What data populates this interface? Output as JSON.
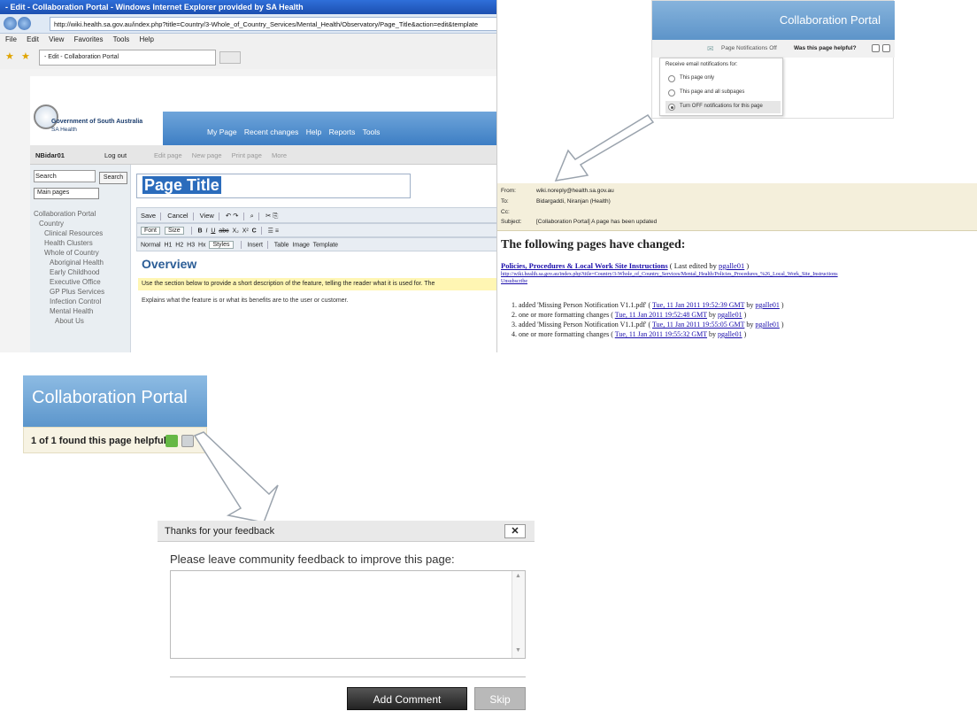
{
  "ie": {
    "title": "- Edit - Collaboration Portal - Windows Internet Explorer provided by SA Health",
    "url": "http://wiki.health.sa.gov.au/index.php?title=Country/3-Whole_of_Country_Services/Mental_Health/Observatory/Page_Title&action=edit&template",
    "menu": [
      "File",
      "Edit",
      "View",
      "Favorites",
      "Tools",
      "Help"
    ],
    "tab": "- Edit - Collaboration Portal"
  },
  "wiki": {
    "gov_line1": "Government of South Australia",
    "gov_line2": "SA Health",
    "nav": [
      "My Page",
      "Recent changes",
      "Help",
      "Reports",
      "Tools"
    ],
    "user": "NBidar01",
    "logout": "Log out",
    "actions": [
      "Edit page",
      "New page",
      "Print page",
      "More"
    ],
    "search_placeholder": "Search",
    "search_button": "Search",
    "select_value": "Main pages",
    "tree": [
      "Collaboration Portal",
      "Country",
      "Clinical Resources",
      "Health Clusters",
      "Whole of Country",
      "Aboriginal Health",
      "Early Childhood",
      "Executive Office",
      "GP Plus Services",
      "Infection Control",
      "Mental Health",
      "About Us"
    ],
    "page_title": "Page Title",
    "tb1": [
      "Save",
      "Cancel",
      "View"
    ],
    "tb2": [
      "Font",
      "Size",
      "B",
      "I",
      "U",
      "abc",
      "X₂",
      "X²",
      "C"
    ],
    "tb3": [
      "Normal",
      "H1",
      "H2",
      "H3",
      "Hx",
      "Styles",
      "Insert",
      "Table",
      "Image",
      "Template"
    ],
    "overview": "Overview",
    "hint": "Use the section below to provide a short description of the feature, telling the reader what it is used for. The",
    "explains": "Explains what the feature is or what its benefits are to the user or customer."
  },
  "notif": {
    "portal_title": "Collaboration Portal",
    "page_notifications": "Page Notifications Off",
    "helpful_q": "Was this page helpful?",
    "menu_title": "Receive email notifications for:",
    "options": [
      "This page only",
      "This page and all subpages",
      "Turn OFF notifications for this page"
    ]
  },
  "email": {
    "from_label": "From:",
    "from": "wiki.noreply@health.sa.gov.au",
    "to_label": "To:",
    "to": "Bidargaddi, Niranjan (Health)",
    "cc_label": "Cc:",
    "subject_label": "Subject:",
    "subject": "[Collaboration Portal] A page has been updated",
    "heading": "The following pages have changed:",
    "page_link": "Policies, Procedures & Local Work Site Instructions",
    "last_edited": " ( Last edited by ",
    "editor": "pgalle01",
    "close": " )",
    "long_url": "http://wiki.health.sa.gov.au/index.php?title=Country/3-Whole_of_Country_Services/Mental_Health/Policies_Procedures_%26_Local_Work_Site_Instructions",
    "unsubscribe": "Unsubscribe",
    "changes": [
      {
        "n": "1.",
        "text": "added 'Missing Person Notification V1.1.pdf' ( ",
        "date": "Tue, 11 Jan 2011 19:52:39 GMT",
        "by": " by ",
        "user": "pgalle01",
        "end": " )"
      },
      {
        "n": "2.",
        "text": "one or more formatting changes ( ",
        "date": "Tue, 11 Jan 2011 19:52:48 GMT",
        "by": " by ",
        "user": "pgalle01",
        "end": " )"
      },
      {
        "n": "3.",
        "text": "added 'Missing Person Notification V1.1.pdf' ( ",
        "date": "Tue, 11 Jan 2011 19:55:05 GMT",
        "by": " by ",
        "user": "pgalle01",
        "end": " )"
      },
      {
        "n": "4.",
        "text": "one or more formatting changes ( ",
        "date": "Tue, 11 Jan 2011 19:55:32 GMT",
        "by": " by ",
        "user": "pgalle01",
        "end": " )"
      }
    ]
  },
  "helpful": {
    "portal_title": "Collaboration Portal",
    "count_text": "1 of 1 found this page helpful"
  },
  "dialog": {
    "title": "Thanks for your feedback",
    "close": "✕",
    "prompt": "Please leave community feedback to improve this page:",
    "textarea_value": "",
    "add_comment": "Add Comment",
    "skip": "Skip"
  },
  "colors": {
    "portal_blue": "#5d94c9",
    "hint_yellow": "#fff6b3",
    "link_blue": "#1a0dab",
    "helpful_green": "#66b845"
  }
}
